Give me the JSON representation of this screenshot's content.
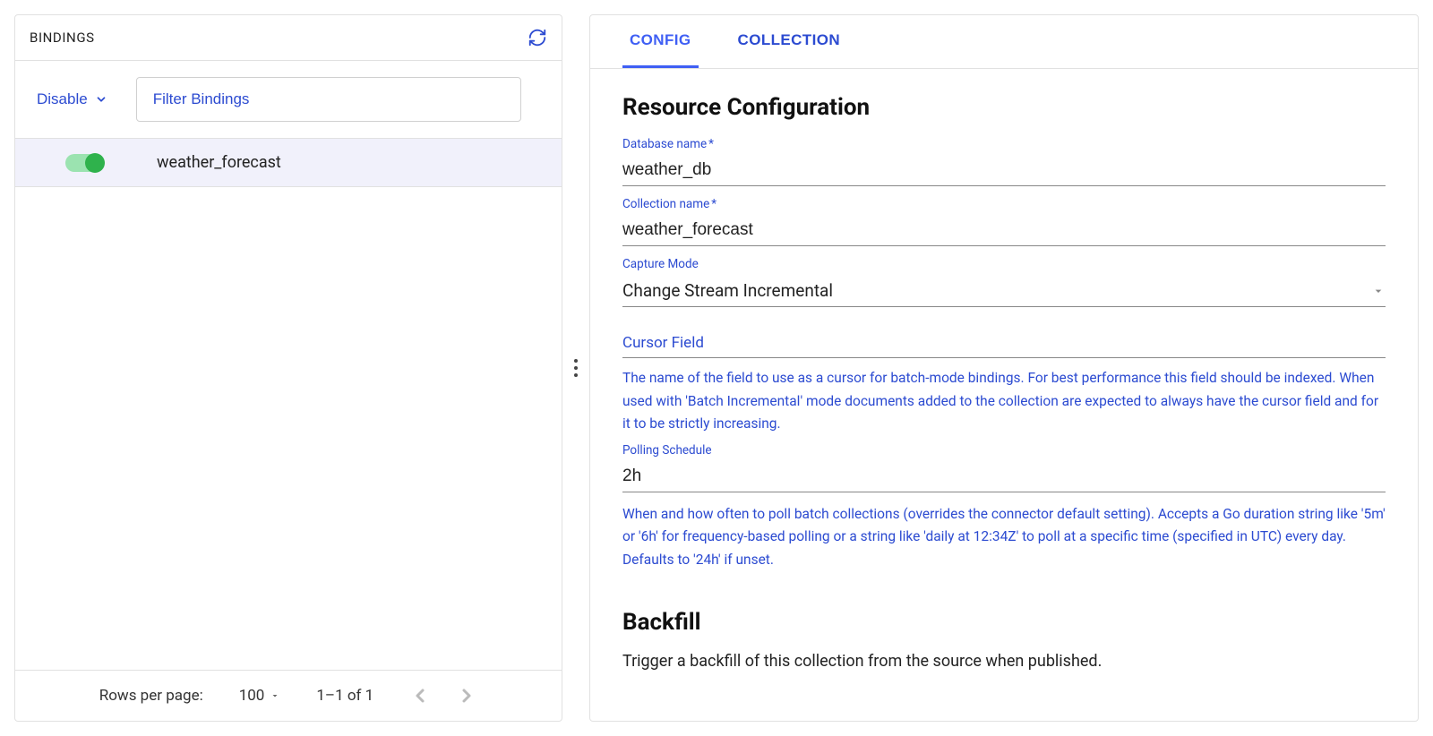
{
  "left": {
    "title": "BINDINGS",
    "disable_label": "Disable",
    "filter_placeholder": "Filter Bindings",
    "binding": {
      "name": "weather_forecast",
      "enabled": true
    },
    "pagination": {
      "rows_label": "Rows per page:",
      "rows_value": "100",
      "range": "1–1 of 1"
    }
  },
  "tabs": {
    "config": "CONFIG",
    "collection": "COLLECTION"
  },
  "config": {
    "title": "Resource Configuration",
    "db_label": "Database name",
    "db_value": "weather_db",
    "coll_label": "Collection name",
    "coll_value": "weather_forecast",
    "mode_label": "Capture Mode",
    "mode_value": "Change Stream Incremental",
    "cursor_label": "Cursor Field",
    "cursor_help": "The name of the field to use as a cursor for batch-mode bindings. For best performance this field should be indexed. When used with 'Batch Incremental' mode documents added to the collection are expected to always have the cursor field and for it to be strictly increasing.",
    "poll_label": "Polling Schedule",
    "poll_value": "2h",
    "poll_help": "When and how often to poll batch collections (overrides the connector default setting). Accepts a Go duration string like '5m' or '6h' for frequency-based polling or a string like 'daily at 12:34Z' to poll at a specific time (specified in UTC) every day. Defaults to '24h' if unset.",
    "backfill_title": "Backfill",
    "backfill_desc": "Trigger a backfill of this collection from the source when published."
  }
}
